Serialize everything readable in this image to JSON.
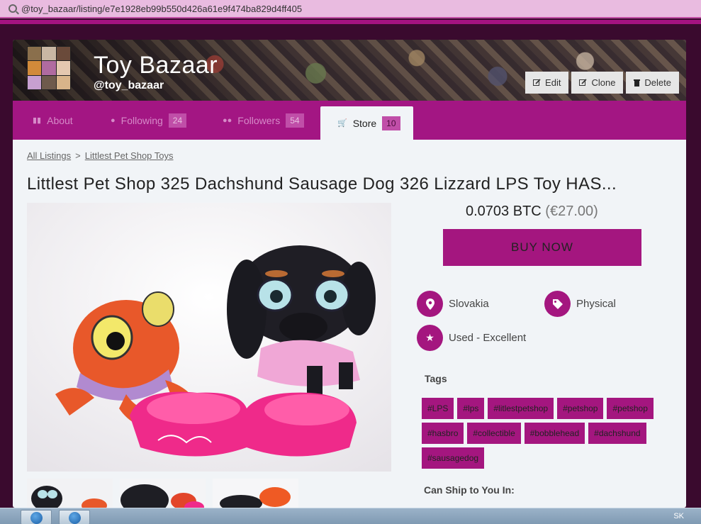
{
  "browser": {
    "url": "@toy_bazaar/listing/e7e1928eb99b550d426a61e9f474ba829d4ff405"
  },
  "store": {
    "name": "Toy Bazaar",
    "handle": "@toy_bazaar"
  },
  "actions": {
    "edit": "Edit",
    "clone": "Clone",
    "delete": "Delete"
  },
  "tabs": [
    {
      "label": "About",
      "count": ""
    },
    {
      "label": "Following",
      "count": "24"
    },
    {
      "label": "Followers",
      "count": "54"
    },
    {
      "label": "Store",
      "count": "10"
    }
  ],
  "breadcrumb": {
    "root": "All Listings",
    "sep": ">",
    "category": "Littlest Pet Shop Toys"
  },
  "listing": {
    "title": "Littlest Pet Shop 325 Dachshund Sausage Dog 326 Lizzard LPS Toy HAS...",
    "price_btc": "0.0703 BTC",
    "price_fiat": "(€27.00)",
    "buy_label": "BUY NOW",
    "location": "Slovakia",
    "type": "Physical",
    "condition": "Used - Excellent",
    "tags_heading": "Tags",
    "tags": [
      "#LPS",
      "#lps",
      "#litlestpetshop",
      "#petshop",
      "#petshop",
      "#hasbro",
      "#collectible",
      "#bobblehead",
      "#dachshund",
      "#sausagedog"
    ],
    "ship_heading": "Can Ship to You In:"
  },
  "system": {
    "lang": "SK"
  },
  "colors": {
    "accent": "#a4167f",
    "page_bg": "#3a0a2e"
  }
}
